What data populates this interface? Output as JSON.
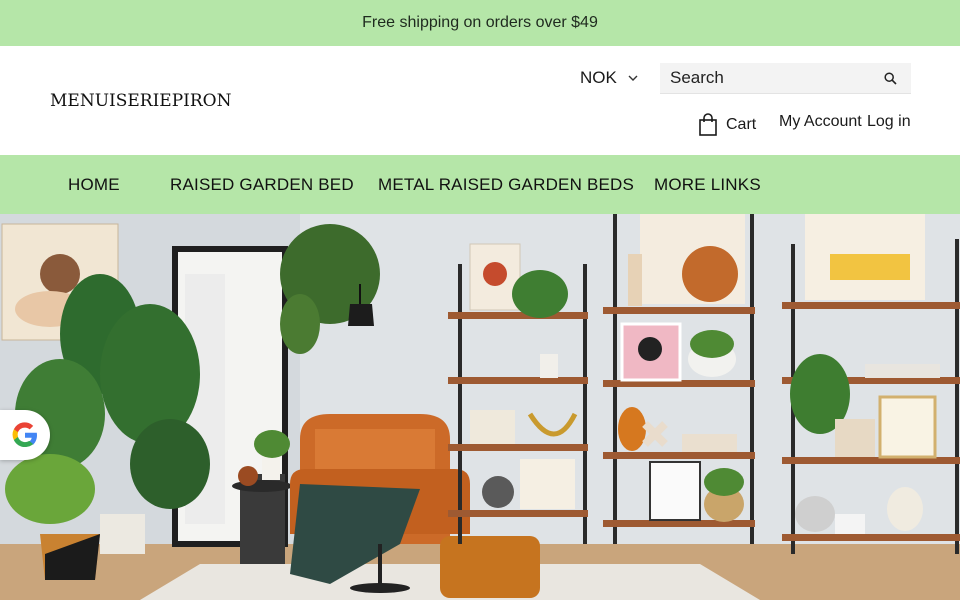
{
  "announcement": "Free shipping on orders over $49",
  "brand": {
    "logo_text": "MENUISERIEPIRON"
  },
  "currency": {
    "selected": "NOK"
  },
  "search": {
    "placeholder": "Search"
  },
  "account": {
    "cart_label": "Cart",
    "my_account_label": "My Account",
    "login_label": "Log in"
  },
  "nav": {
    "items": [
      {
        "label": "HOME"
      },
      {
        "label": "RAISED GARDEN BED"
      },
      {
        "label": "METAL RAISED GARDEN BEDS"
      },
      {
        "label": "MORE LINKS"
      }
    ]
  },
  "colors": {
    "accent_green": "#b5e6a8",
    "text": "#1a1a1a"
  },
  "icons": [
    "chevron-down-icon",
    "search-icon",
    "bag-icon",
    "google-icon"
  ]
}
